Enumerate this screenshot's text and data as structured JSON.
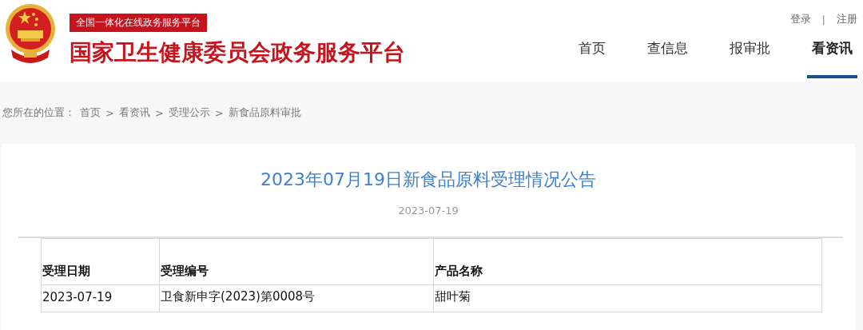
{
  "header": {
    "platform_badge": "全国一体化在线政务服务平台",
    "site_title": "国家卫生健康委员会政务服务平台",
    "account_links": [
      "登录",
      "注册"
    ],
    "account_separator": "|",
    "nav": [
      {
        "label": "首页",
        "selected": false
      },
      {
        "label": "查信息",
        "selected": false
      },
      {
        "label": "报审批",
        "selected": false
      },
      {
        "label": "看资讯",
        "selected": true
      }
    ]
  },
  "breadcrumb": {
    "prefix": "您所在的位置：",
    "items": [
      "首页",
      "看资讯",
      "受理公示",
      "新食品原料审批"
    ],
    "separator": ">"
  },
  "article": {
    "title": "2023年07月19日新食品原料受理情况公告",
    "date": "2023-07-19",
    "table": {
      "columns": [
        "受理日期",
        "受理编号",
        "产品名称"
      ],
      "rows": [
        [
          "2023-07-19",
          "卫食新申字(2023)第0008号",
          "甜叶菊"
        ]
      ]
    }
  }
}
